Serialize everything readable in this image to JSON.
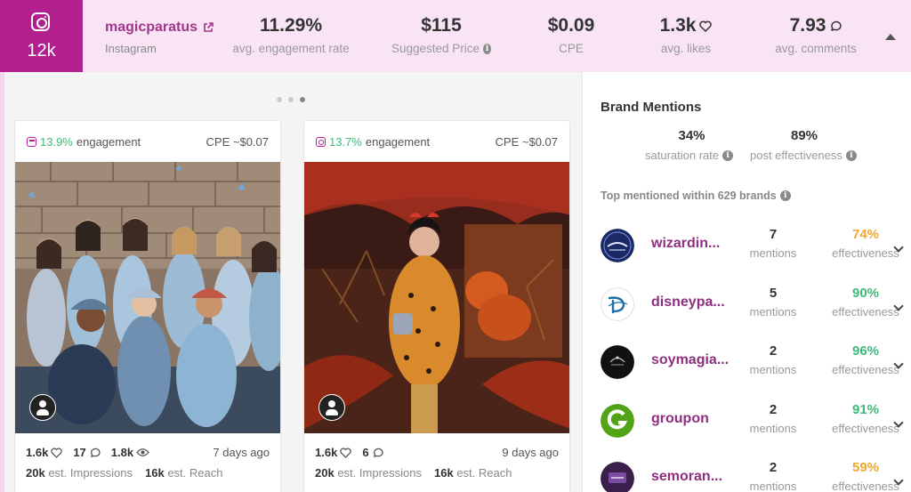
{
  "header": {
    "followers": "12k",
    "handle": "magicparatus",
    "platform": "Instagram",
    "stats": [
      {
        "value": "11.29%",
        "label": "avg. engagement rate"
      },
      {
        "value": "$115",
        "label": "Suggested Price"
      },
      {
        "value": "$0.09",
        "label": "CPE"
      },
      {
        "value": "1.3k",
        "label": "avg. likes"
      },
      {
        "value": "7.93",
        "label": "avg. comments"
      }
    ]
  },
  "posts": [
    {
      "engagement": "13.9%",
      "engagement_label": "engagement",
      "cpe": "CPE ~$0.07",
      "likes": "1.6k",
      "comments": "17",
      "views": "1.8k",
      "ago": "7 days ago",
      "impressions": "20k",
      "impressions_label": "est. Impressions",
      "reach": "16k",
      "reach_label": "est. Reach"
    },
    {
      "engagement": "13.7%",
      "engagement_label": "engagement",
      "cpe": "CPE ~$0.07",
      "likes": "1.6k",
      "comments": "6",
      "ago": "9 days ago",
      "impressions": "20k",
      "impressions_label": "est. Impressions",
      "reach": "16k",
      "reach_label": "est. Reach"
    }
  ],
  "brand_mentions": {
    "title": "Brand Mentions",
    "saturation_rate": "34%",
    "saturation_label": "saturation rate",
    "post_effectiveness": "89%",
    "post_effectiveness_label": "post effectiveness",
    "top_label": "Top mentioned within 629 brands",
    "mentions_label": "mentions",
    "effectiveness_label": "effectiveness",
    "brands": [
      {
        "name": "wizardin...",
        "mentions": "7",
        "effectiveness": "74%",
        "eff_color": "#f0a830"
      },
      {
        "name": "disneypa...",
        "mentions": "5",
        "effectiveness": "90%",
        "eff_color": "#3dbb7a"
      },
      {
        "name": "soymagia...",
        "mentions": "2",
        "effectiveness": "96%",
        "eff_color": "#3dbb7a"
      },
      {
        "name": "groupon",
        "mentions": "2",
        "effectiveness": "91%",
        "eff_color": "#3dbb7a"
      },
      {
        "name": "semoran...",
        "mentions": "2",
        "effectiveness": "59%",
        "eff_color": "#f0a830"
      }
    ]
  },
  "colors": {
    "accent": "#b21f8f",
    "brand_link": "#8e2f7f",
    "positive": "#3dbb7a",
    "warning": "#f0a830"
  }
}
